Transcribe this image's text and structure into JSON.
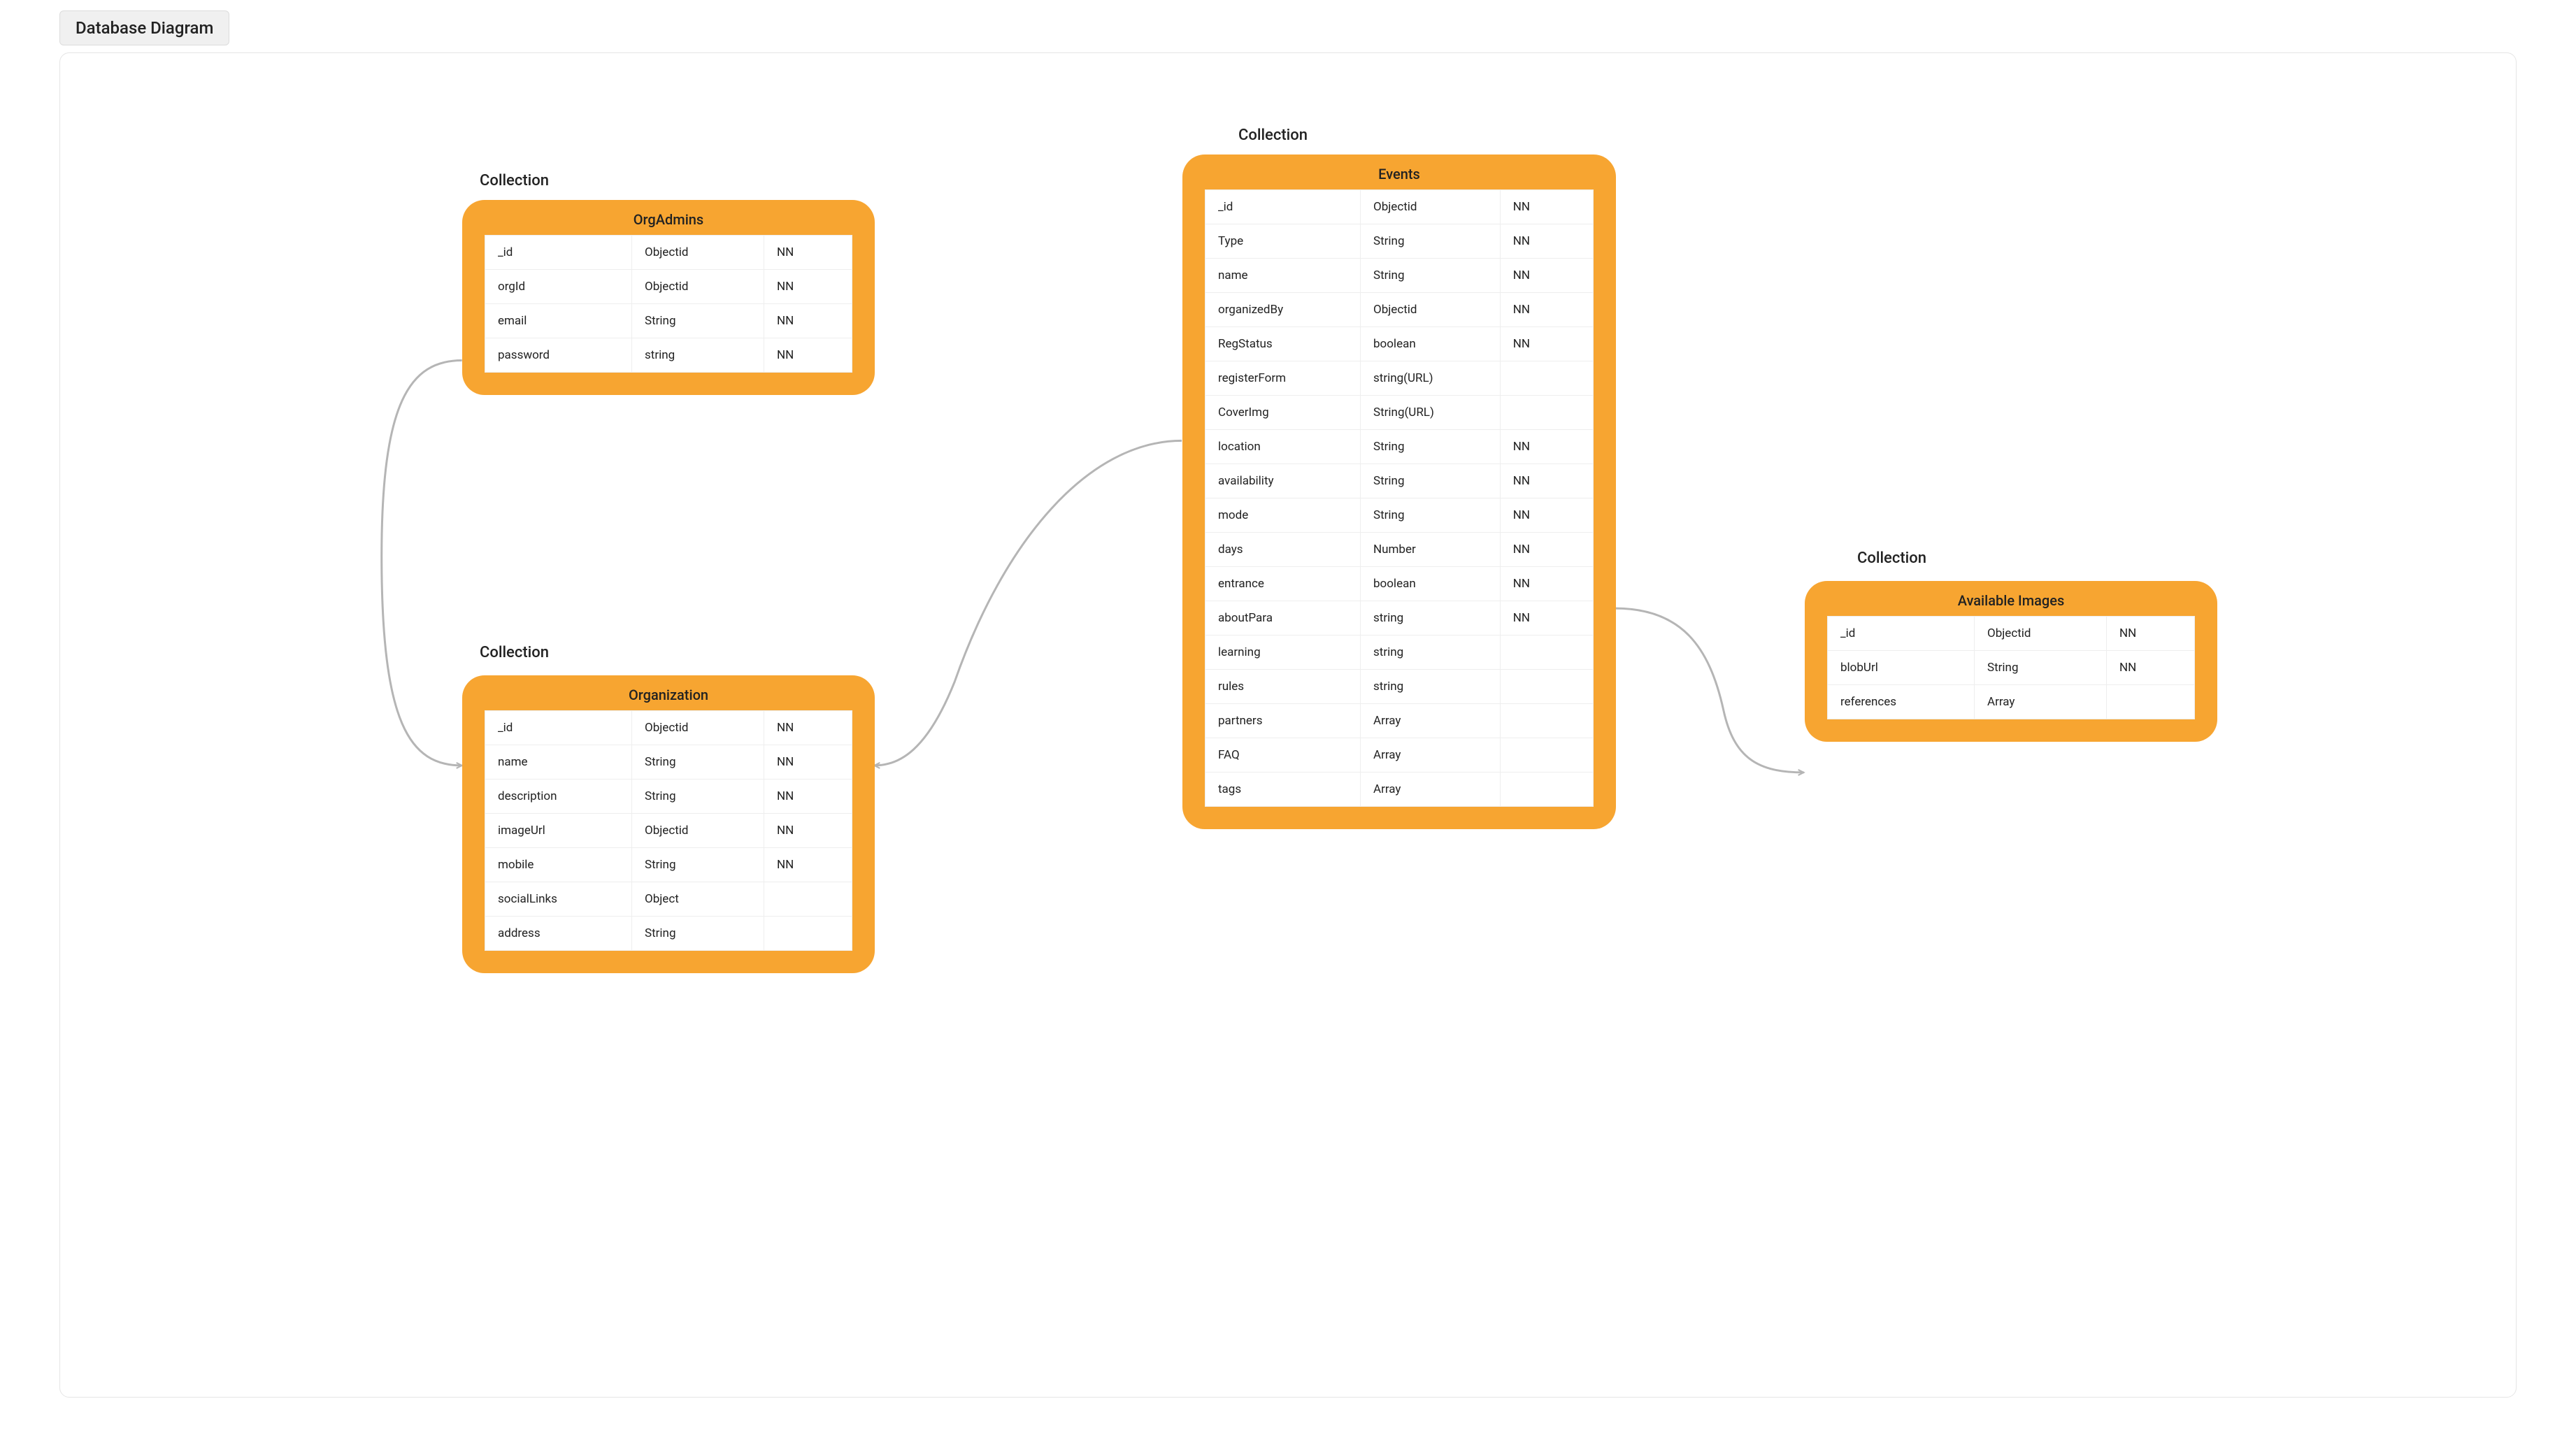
{
  "tab_label": "Database Diagram",
  "collection_label": "Collection",
  "collections": {
    "orgadmins": {
      "title": "OrgAdmins",
      "fields": [
        {
          "name": "_id",
          "type": "Objectid",
          "nn": "NN"
        },
        {
          "name": "orgId",
          "type": "Objectid",
          "nn": "NN"
        },
        {
          "name": "email",
          "type": "String",
          "nn": "NN"
        },
        {
          "name": "password",
          "type": "string",
          "nn": "NN"
        }
      ]
    },
    "organization": {
      "title": "Organization",
      "fields": [
        {
          "name": "_id",
          "type": "Objectid",
          "nn": "NN"
        },
        {
          "name": "name",
          "type": "String",
          "nn": "NN"
        },
        {
          "name": "description",
          "type": "String",
          "nn": "NN"
        },
        {
          "name": "imageUrl",
          "type": "Objectid",
          "nn": "NN"
        },
        {
          "name": "mobile",
          "type": "String",
          "nn": "NN"
        },
        {
          "name": "socialLinks",
          "type": "Object",
          "nn": ""
        },
        {
          "name": "address",
          "type": "String",
          "nn": ""
        }
      ]
    },
    "events": {
      "title": "Events",
      "fields": [
        {
          "name": "_id",
          "type": "Objectid",
          "nn": "NN"
        },
        {
          "name": "Type",
          "type": "String",
          "nn": "NN"
        },
        {
          "name": "name",
          "type": "String",
          "nn": "NN"
        },
        {
          "name": "organizedBy",
          "type": "Objectid",
          "nn": "NN"
        },
        {
          "name": "RegStatus",
          "type": "boolean",
          "nn": "NN"
        },
        {
          "name": "registerForm",
          "type": "string(URL)",
          "nn": ""
        },
        {
          "name": "CoverImg",
          "type": "String(URL)",
          "nn": ""
        },
        {
          "name": "location",
          "type": "String",
          "nn": "NN"
        },
        {
          "name": "availability",
          "type": "String",
          "nn": "NN"
        },
        {
          "name": "mode",
          "type": "String",
          "nn": "NN"
        },
        {
          "name": "days",
          "type": "Number",
          "nn": "NN"
        },
        {
          "name": "entrance",
          "type": "boolean",
          "nn": "NN"
        },
        {
          "name": "aboutPara",
          "type": "string",
          "nn": "NN"
        },
        {
          "name": "learning",
          "type": "string",
          "nn": ""
        },
        {
          "name": "rules",
          "type": "string",
          "nn": ""
        },
        {
          "name": "partners",
          "type": "Array",
          "nn": ""
        },
        {
          "name": "FAQ",
          "type": "Array",
          "nn": ""
        },
        {
          "name": "tags",
          "type": "Array",
          "nn": ""
        }
      ]
    },
    "images": {
      "title": "Available Images",
      "fields": [
        {
          "name": "_id",
          "type": "Objectid",
          "nn": "NN"
        },
        {
          "name": "blobUrl",
          "type": "String",
          "nn": "NN"
        },
        {
          "name": "references",
          "type": "Array",
          "nn": ""
        }
      ]
    }
  },
  "connections": [
    {
      "from": "orgadmins",
      "to": "organization"
    },
    {
      "from": "events",
      "to": "organization"
    },
    {
      "from": "events",
      "to": "images"
    }
  ],
  "colors": {
    "card_bg": "#f7a531",
    "border": "#e5e5e5",
    "arrow": "#b5b5b5"
  }
}
